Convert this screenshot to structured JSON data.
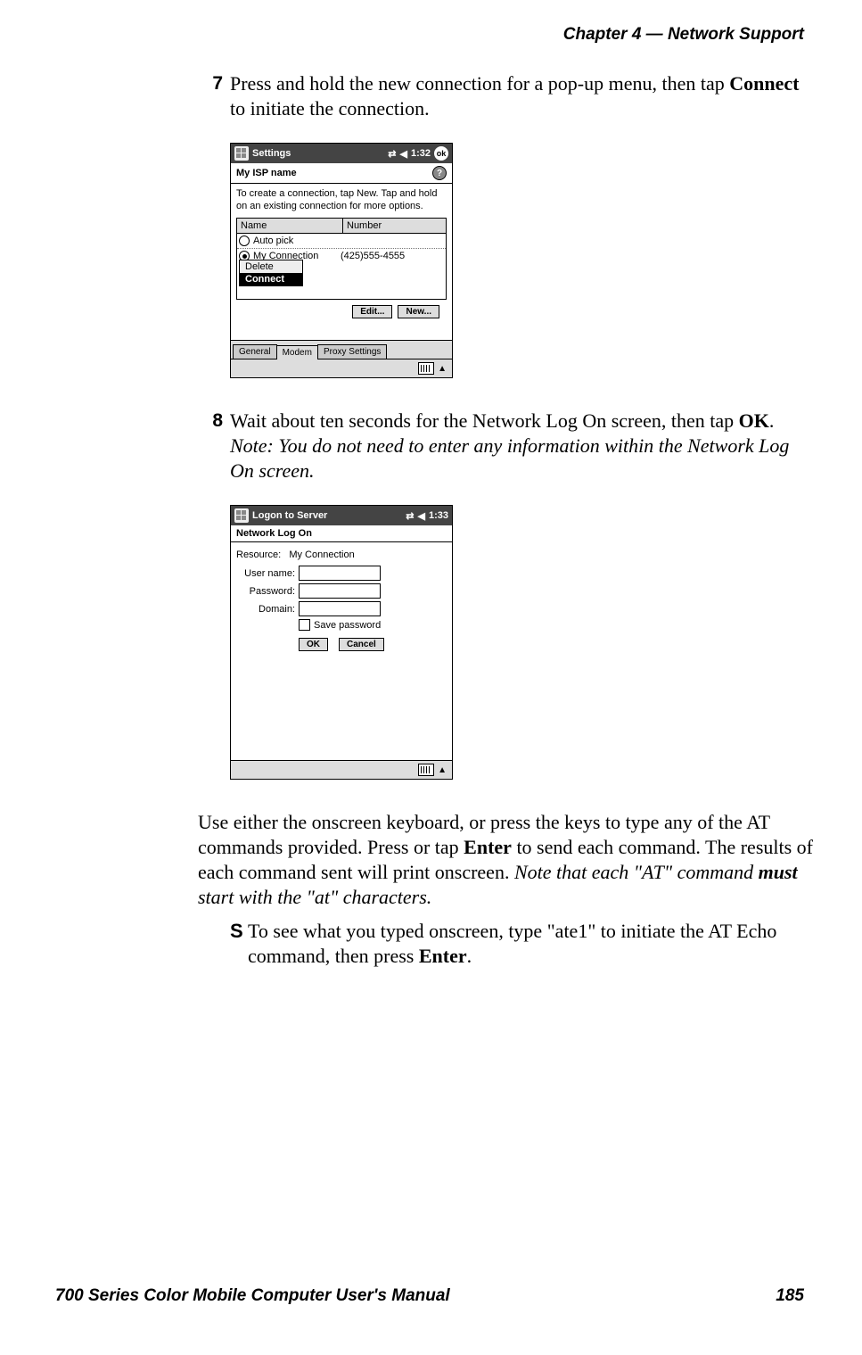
{
  "header": {
    "text": "Chapter  4  —  Network Support"
  },
  "footer": {
    "left": "700 Series Color Mobile Computer User's Manual",
    "right": "185"
  },
  "step7": {
    "num": "7",
    "t1": "Press and hold the new connection for a pop-up menu, then tap ",
    "t2": "Connect",
    "t3": " to initiate the connection."
  },
  "shot1": {
    "title": "Settings",
    "time": "1:32",
    "ok": "ok",
    "subtitle": "My ISP name",
    "instr": "To create a connection, tap New. Tap and hold on an existing connection for more options.",
    "col1": "Name",
    "col2": "Number",
    "row1": "Auto pick",
    "row2name": "My Connection",
    "row2num": "(425)555-4555",
    "menu_delete": "Delete",
    "menu_connect": "Connect",
    "btn_edit": "Edit...",
    "btn_new": "New...",
    "tab1": "General",
    "tab2": "Modem",
    "tab3": "Proxy Settings"
  },
  "step8": {
    "num": "8",
    "t1": "Wait about ten seconds for the Network Log On screen, then tap ",
    "t2": "OK",
    "t3": ". ",
    "note": "Note: You do not need to enter any information within the Network Log On screen."
  },
  "shot2": {
    "title": "Logon to Server",
    "time": "1:33",
    "subtitle": "Network Log On",
    "resource_lbl": "Resource:",
    "resource_val": "My Connection",
    "user_lbl": "User name:",
    "pass_lbl": "Password:",
    "domain_lbl": "Domain:",
    "save_pw": "Save password",
    "btn_ok": "OK",
    "btn_cancel": "Cancel"
  },
  "para1": {
    "t1": "Use either the onscreen keyboard, or press the keys to type any of the AT commands provided. Press or tap ",
    "t2": "Enter",
    "t3": " to send each command. The results of each command sent will print onscreen. ",
    "t4": "Note that each \"AT\" command ",
    "t5": "must",
    "t6": " start with the \"at\" characters."
  },
  "bullet1": {
    "mark": "S",
    "t1": "To see what you typed onscreen, type \"ate1\" to initiate the AT Echo command, then press ",
    "t2": "Enter",
    "t3": "."
  }
}
